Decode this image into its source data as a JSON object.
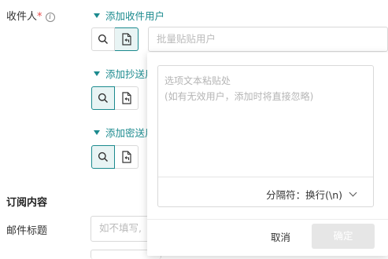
{
  "recipients": {
    "label": "收件人",
    "required_mark": "*",
    "info_glyph": "i"
  },
  "sections": {
    "to_label": "添加收件用户",
    "cc_label": "添加抄送用",
    "bcc_label": "添加密送用"
  },
  "batch_input": {
    "placeholder": "批量贴贴用户"
  },
  "paste_popover": {
    "placeholder_line1": "选项文本粘贴处",
    "placeholder_line2": "(如有无效用户，添加时将直接忽略)",
    "separator_label": "分隔符：换行(\\n)",
    "cancel_label": "取消",
    "confirm_label": "确定"
  },
  "subscription": {
    "section_title": "订阅内容",
    "mail_title_label": "邮件标题",
    "mail_title_placeholder": "如不填写,"
  },
  "colors": {
    "accent": "#1b8a8e",
    "required": "#e84a4a"
  },
  "icons": [
    "search-icon",
    "paste-file-icon",
    "chevron-down-icon",
    "info-icon"
  ]
}
